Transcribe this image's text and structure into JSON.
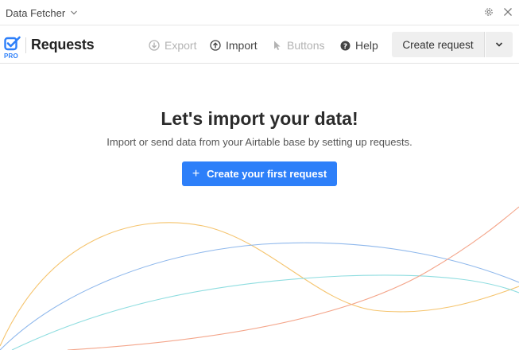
{
  "titlebar": {
    "app_name": "Data Fetcher",
    "settings_icon": "gear-icon",
    "close_icon": "close-icon"
  },
  "toolbar": {
    "logo_badge": "PRO",
    "title": "Requests",
    "buttons": [
      {
        "label": "Export",
        "icon": "export-icon",
        "enabled": false
      },
      {
        "label": "Import",
        "icon": "import-icon",
        "enabled": true
      },
      {
        "label": "Buttons",
        "icon": "cursor-icon",
        "enabled": false
      },
      {
        "label": "Help",
        "icon": "help-icon",
        "enabled": true
      }
    ],
    "create_label": "Create request"
  },
  "empty_state": {
    "heading": "Let's import your data!",
    "description": "Import or send data from your Airtable base by setting up requests.",
    "cta_label": "Create your first request"
  },
  "colors": {
    "accent": "#2d7ff9",
    "disabled_text": "#b3b3b3",
    "curve_orange": "#f5c46e",
    "curve_blue": "#8fb8ec",
    "curve_teal": "#8fdde0",
    "curve_red": "#f4a58a"
  }
}
